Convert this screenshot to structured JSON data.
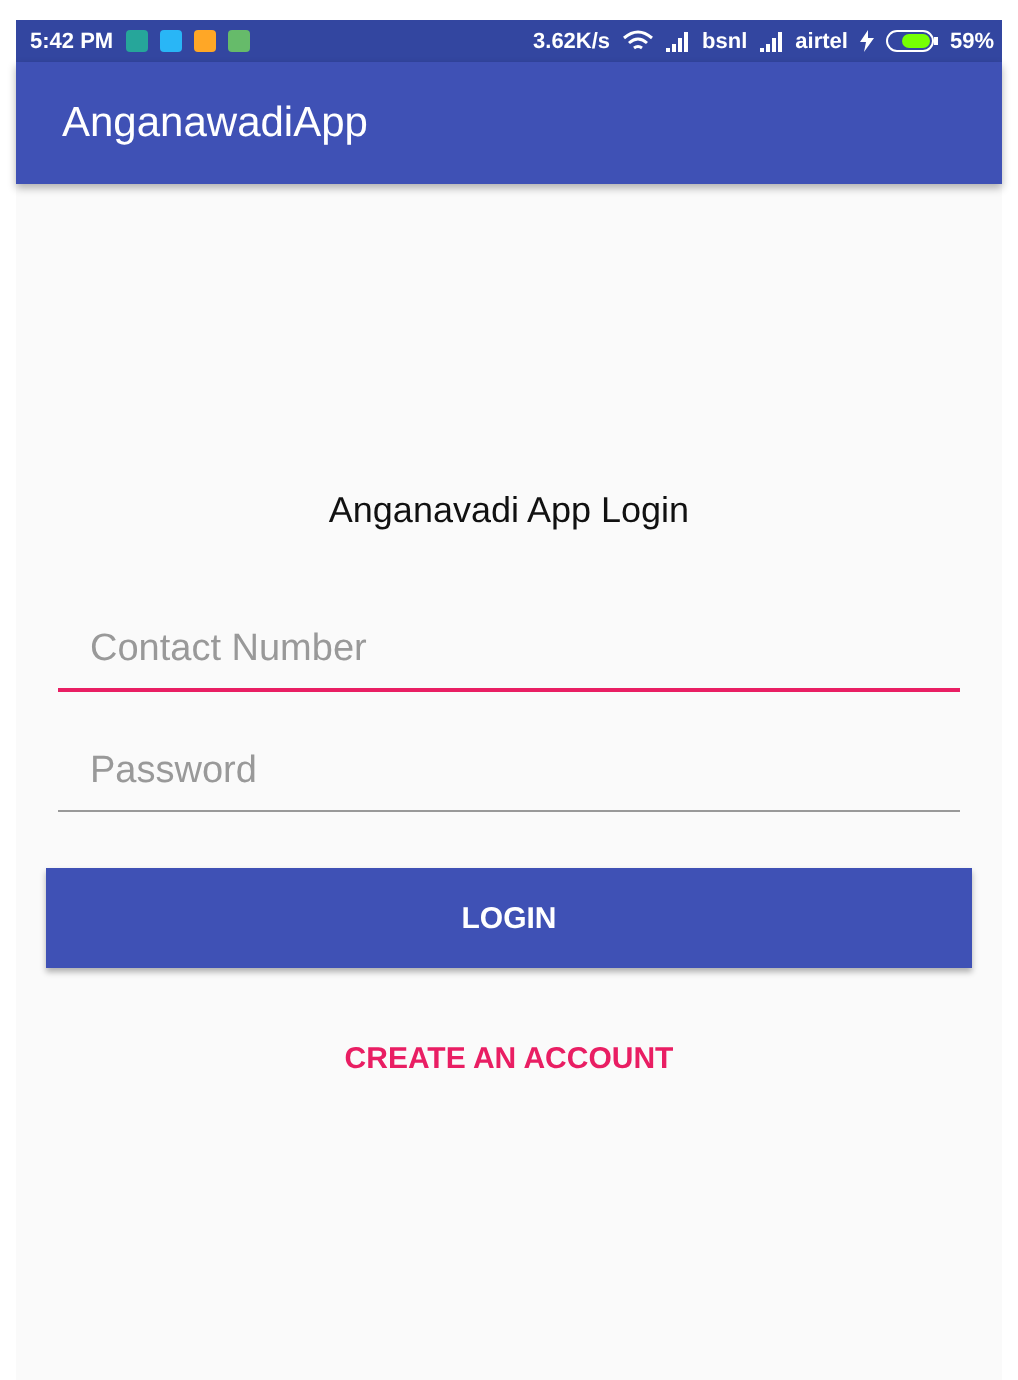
{
  "status_bar": {
    "time": "5:42 PM",
    "notification_icons": [
      {
        "color": "#26a69a"
      },
      {
        "color": "#29b6f6"
      },
      {
        "color": "#ffa726"
      },
      {
        "color": "#66bb6a"
      }
    ],
    "speed": "3.62K/s",
    "carriers": [
      "bsnl",
      "airtel"
    ],
    "battery": "59%"
  },
  "app_bar": {
    "title": "AnganawadiApp"
  },
  "form": {
    "heading": "Anganavadi App Login",
    "fields": [
      {
        "placeholder": "Contact Number",
        "focused": true
      },
      {
        "placeholder": "Password",
        "focused": false
      }
    ],
    "login_button": "LOGIN",
    "create_account_link": "CREATE AN ACCOUNT"
  }
}
